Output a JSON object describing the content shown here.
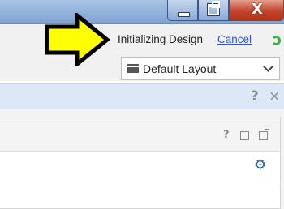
{
  "window_controls": {
    "close_glyph": "X"
  },
  "toolbar": {
    "status_text": "Initializing Design",
    "cancel_label": "Cancel",
    "layout_dropdown": {
      "selected": "Default Layout"
    }
  },
  "info_band": {
    "help_glyph": "?",
    "close_glyph": "×"
  },
  "panel": {
    "help_glyph": "?",
    "settings_glyph": "⚙"
  },
  "colors": {
    "annotation_arrow": "#ffff00",
    "link": "#2a57c8",
    "spinner": "#37b34a",
    "info_band": "#dce8f8",
    "settings_icon": "#245fa3"
  }
}
